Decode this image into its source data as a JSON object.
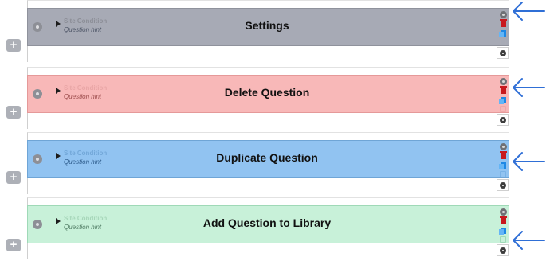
{
  "panels": [
    {
      "key": "settings",
      "site_condition": "Site Condition",
      "question_hint": "Question hint",
      "title": "Settings",
      "colors": {
        "bg": "#a7aab5",
        "border": "#8f929c",
        "text": "#8c8e97",
        "hint": "#4d5566"
      },
      "lib_color": "#a9abb5",
      "arrow_target": "settings-gear"
    },
    {
      "key": "delete",
      "site_condition": "Site Condition",
      "question_hint": "Question hint",
      "title": "Delete Question",
      "colors": {
        "bg": "#f8b8b8",
        "border": "#e59999",
        "text": "#e9a6a6",
        "hint": "#9b4a4a"
      },
      "lib_color": "#f0a8a8",
      "arrow_target": "delete-trash"
    },
    {
      "key": "duplicate",
      "site_condition": "Site Condition",
      "question_hint": "Question hint",
      "title": "Duplicate Question",
      "colors": {
        "bg": "#91c3f1",
        "border": "#6fa5d6",
        "text": "#72a7d8",
        "hint": "#2c5a8a"
      },
      "lib_color": "#79b2e6",
      "arrow_target": "duplicate-copy"
    },
    {
      "key": "library",
      "site_condition": "Site Condition",
      "question_hint": "Question hint",
      "title": "Add Question to Library",
      "colors": {
        "bg": "#c8f1d9",
        "border": "#9fd9b7",
        "text": "#a6d6b9",
        "hint": "#4e7a62"
      },
      "lib_color": "#9fd9b7",
      "arrow_target": "add-to-library"
    }
  ],
  "add_button_glyph": "+",
  "arrow_color": "#2f6fd6"
}
